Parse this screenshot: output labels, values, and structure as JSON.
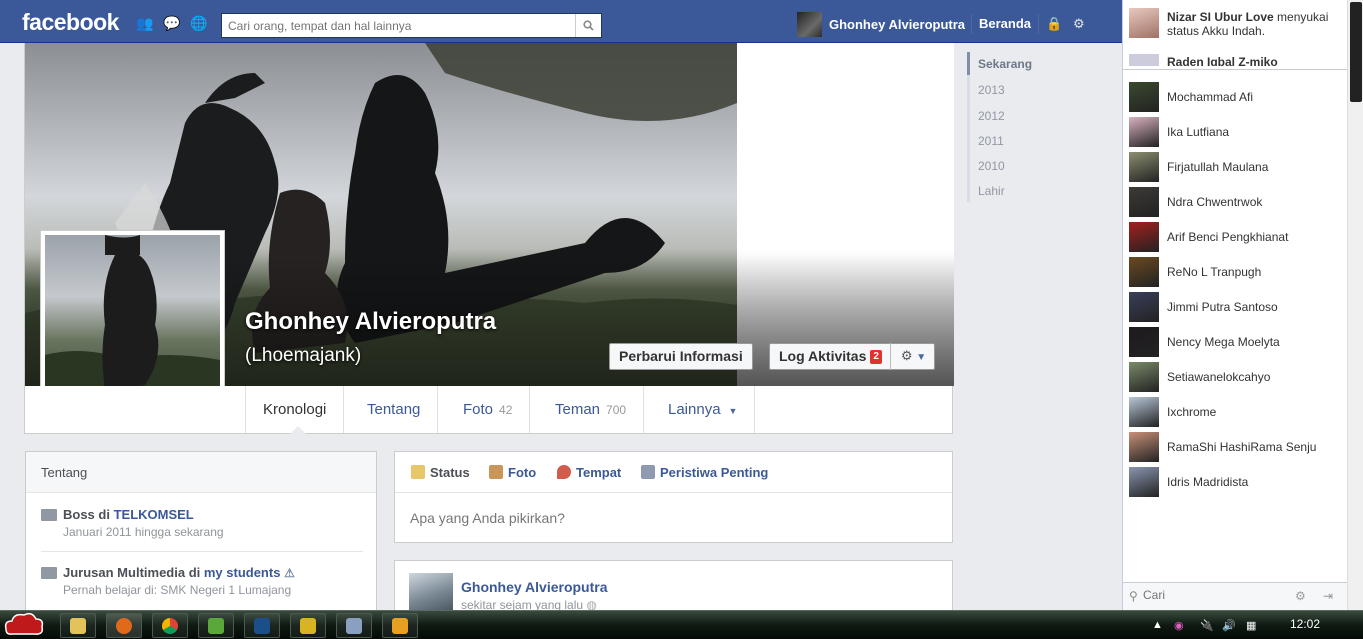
{
  "header": {
    "logo": "facebook",
    "search_placeholder": "Cari orang, tempat dan hal lainnya",
    "user_name": "Ghonhey Alvieroputra",
    "home_label": "Beranda"
  },
  "profile": {
    "name": "Ghonhey Alvieroputra",
    "alt_name": "(Lhoemajank)",
    "update_button": "Perbarui Informasi",
    "activity_log_button": "Log Aktivitas",
    "activity_badge": "2"
  },
  "tabs": [
    {
      "label": "Kronologi",
      "count": ""
    },
    {
      "label": "Tentang",
      "count": ""
    },
    {
      "label": "Foto",
      "count": "42"
    },
    {
      "label": "Teman",
      "count": "700"
    },
    {
      "label": "Lainnya",
      "count": ""
    }
  ],
  "about": {
    "title": "Tentang",
    "work_prefix": "Boss di ",
    "work_place": "TELKOMSEL",
    "work_period": "Januari 2011 hingga sekarang",
    "edu_prefix": "Jurusan Multimedia di ",
    "edu_place": "my students",
    "edu_detail": "Pernah belajar di: SMK Negeri 1 Lumajang"
  },
  "composer": {
    "tabs": [
      "Status",
      "Foto",
      "Tempat",
      "Peristiwa Penting"
    ],
    "placeholder": "Apa yang Anda pikirkan?"
  },
  "post": {
    "author": "Ghonhey Alvieroputra",
    "time": "sekitar sejam yang lalu"
  },
  "timeline_years": [
    "Sekarang",
    "2013",
    "2012",
    "2011",
    "2010",
    "Lahir"
  ],
  "ticker": {
    "actor": "Nizar SI Ubur Love",
    "action": " menyukai status Akku Indah.",
    "peek": "Raden Iqbal Z-miko"
  },
  "chat": {
    "friends": [
      {
        "name": "Mochammad Afi",
        "color": "#3a4a2e"
      },
      {
        "name": "Ika Lutfiana",
        "color": "#d9b2c0"
      },
      {
        "name": "Firjatullah Maulana",
        "color": "#8a8f70"
      },
      {
        "name": "Ndra Chwentrwok",
        "color": "#3d3a36"
      },
      {
        "name": "Arif Benci Pengkhianat",
        "color": "#a61e1e"
      },
      {
        "name": "ReNo L Tranpugh",
        "color": "#6b4a20"
      },
      {
        "name": "Jimmi Putra Santoso",
        "color": "#3a3f5a"
      },
      {
        "name": "Nency Mega Moelyta",
        "color": "#1e1a20"
      },
      {
        "name": "Setiawanelokcahyo",
        "color": "#7a8a6a"
      },
      {
        "name": "Ixchrome",
        "color": "#b8c8d8"
      },
      {
        "name": "RamaShi HashiRama Senju",
        "color": "#c89078"
      },
      {
        "name": "Idris Madridista",
        "color": "#8a96b0"
      }
    ],
    "search_placeholder": "Cari"
  },
  "taskbar": {
    "clock": "12:02"
  }
}
